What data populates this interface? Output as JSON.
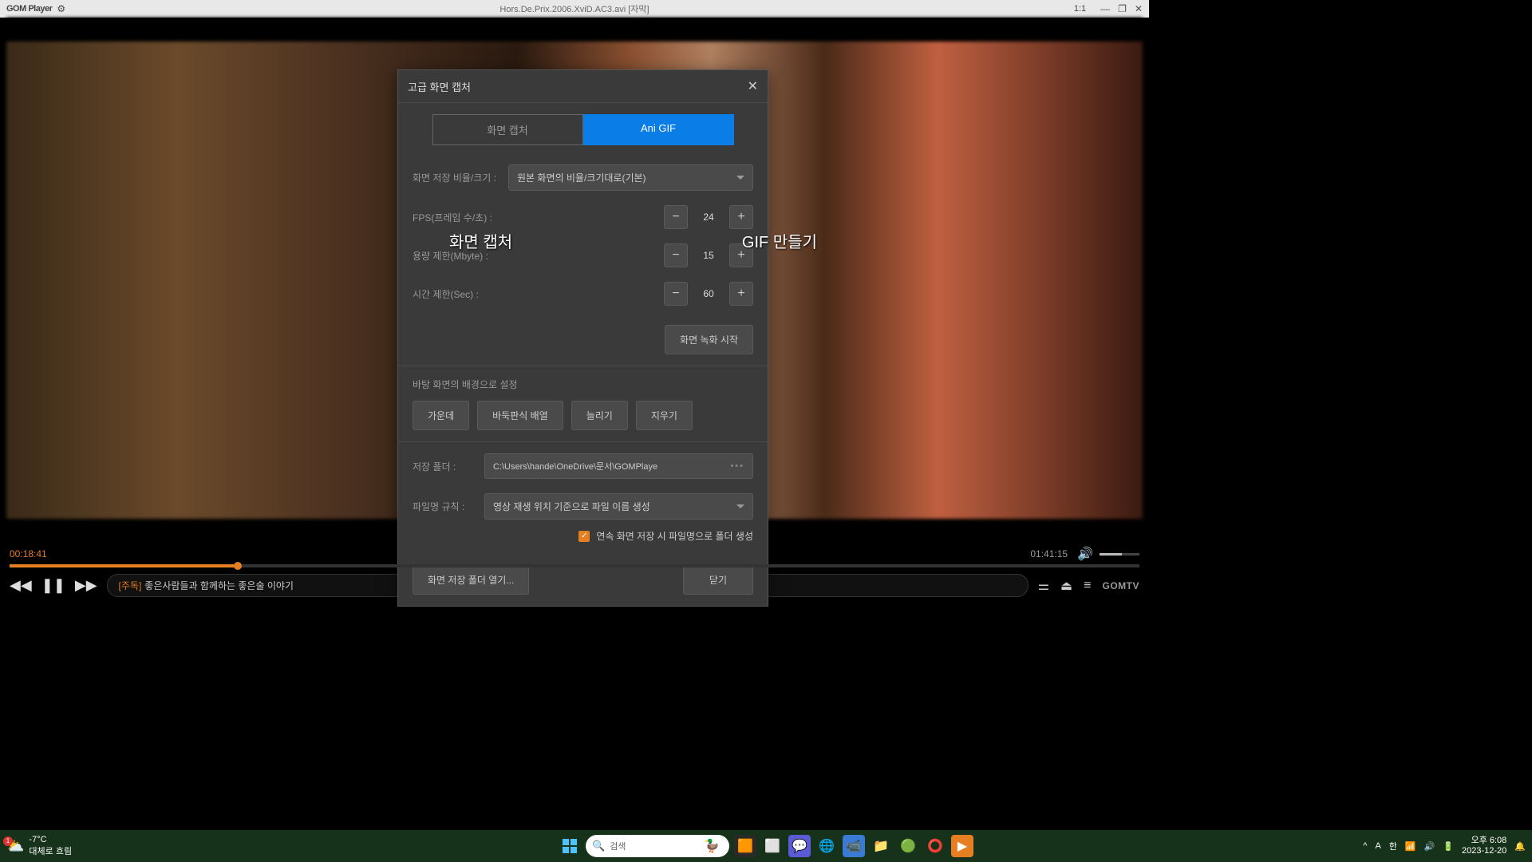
{
  "titlebar": {
    "appName": "GOM Player",
    "fileTitle": "Hors.De.Prix.2006.XviD.AC3.avi [자막]",
    "ratio": "1:1"
  },
  "dialog": {
    "title": "고급 화면 캡처",
    "tabs": {
      "capture": "화면 캡처",
      "anigif": "Ani GIF"
    },
    "annotations": {
      "left": "화면 캡처",
      "right": "GIF 만들기"
    },
    "ratioLabel": "화면 저장 비율/크기 :",
    "ratioValue": "원본 화면의 비율/크기대로(기본)",
    "fpsLabel": "FPS(프레임 수/초) :",
    "fpsValue": "24",
    "sizeLabel": "용량 제한(Mbyte) :",
    "sizeValue": "15",
    "timeLabel": "시간 제한(Sec) :",
    "timeValue": "60",
    "startRec": "화면 녹화 시작",
    "wallpaperTitle": "바탕 화면의 배경으로 설정",
    "wp": {
      "center": "가운데",
      "tile": "바둑판식 배열",
      "stretch": "늘리기",
      "clear": "지우기"
    },
    "folderLabel": "저장 폴더 :",
    "folderPath": "C:\\Users\\hande\\OneDrive\\문서\\GOMPlaye",
    "ruleLabel": "파일명 규칙 :",
    "ruleValue": "영상 재생 위치 기준으로 파일 이름 생성",
    "checkboxLabel": "연속 화면 저장 시 파일명으로 폴더 생성",
    "openFolder": "화면 저장 폴더 열기...",
    "close": "닫기"
  },
  "player": {
    "currentTime": "00:18:41",
    "totalTime": "01:41:15",
    "tickerTag": "[주독]",
    "tickerText": "좋은사람들과 함께하는 좋은술 이야기",
    "gomtv": "GOMTV"
  },
  "taskbar": {
    "temp": "-7°C",
    "weather": "대체로 흐림",
    "weatherBadge": "1",
    "searchPlaceholder": "검색",
    "lang": "한",
    "ime": "A",
    "time": "오후 6:08",
    "date": "2023-12-20"
  }
}
